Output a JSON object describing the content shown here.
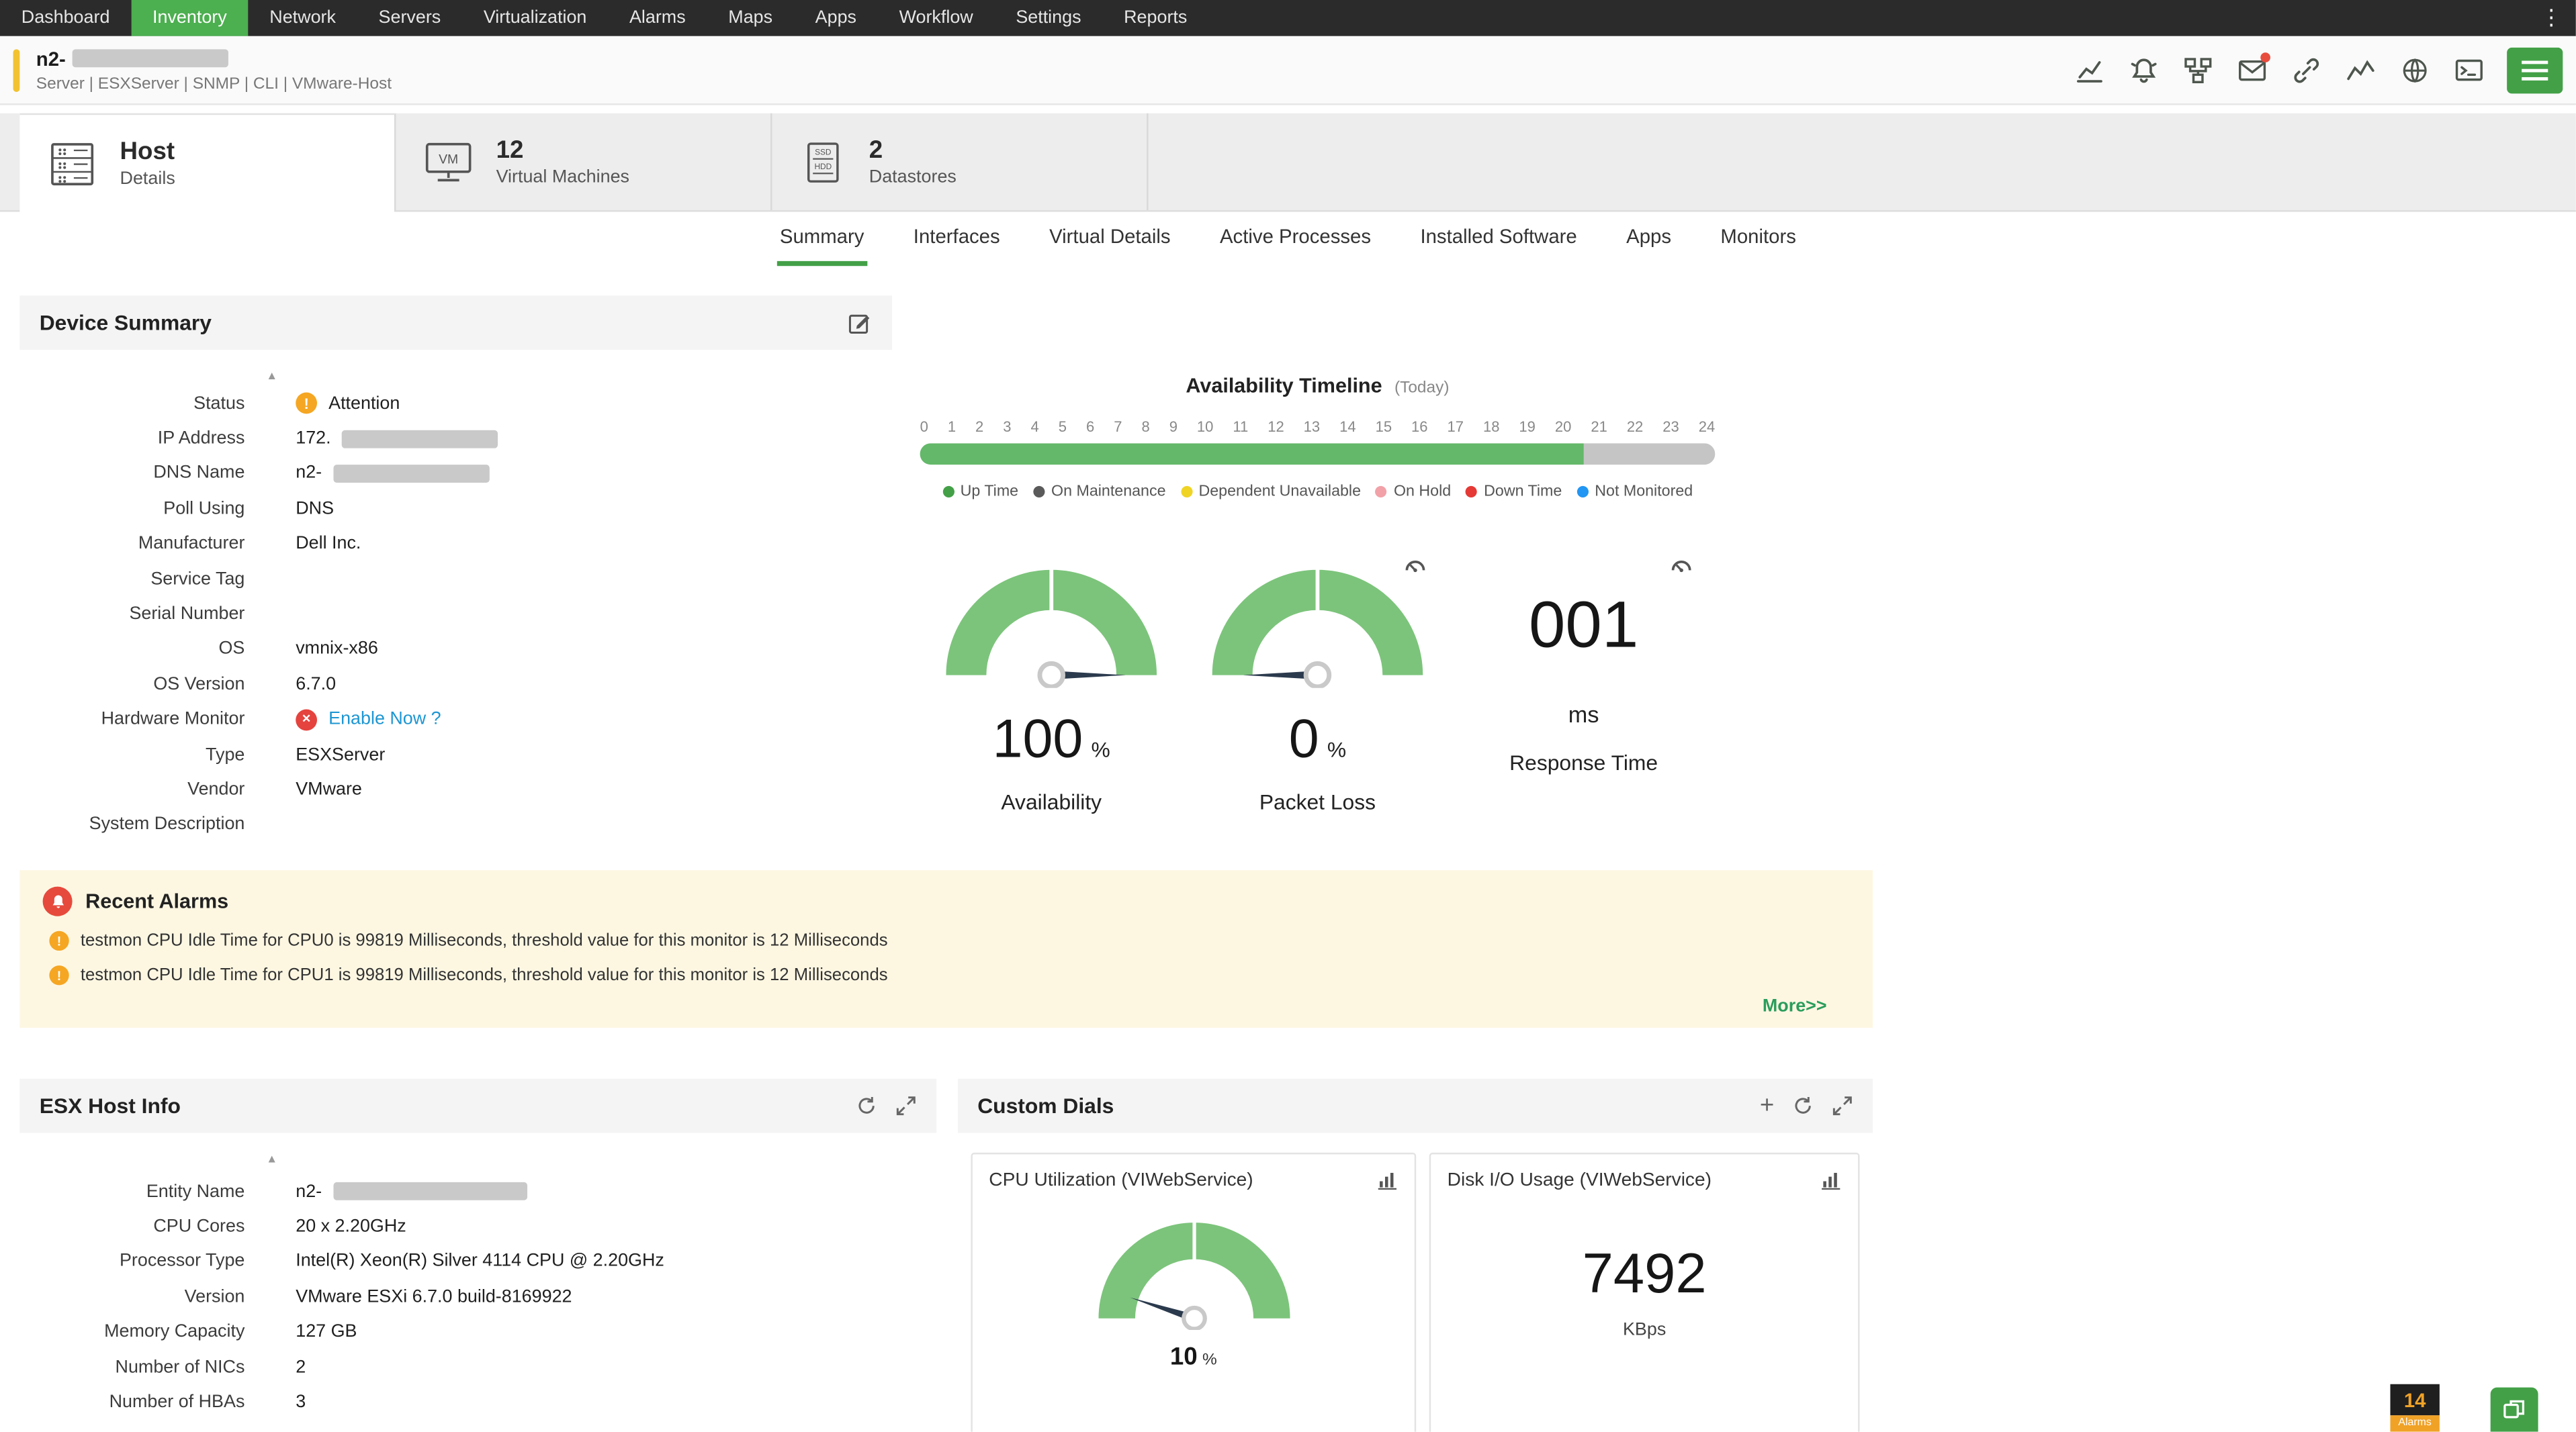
{
  "topnav": {
    "items": [
      {
        "label": "Dashboard",
        "active": false
      },
      {
        "label": "Inventory",
        "active": true
      },
      {
        "label": "Network",
        "active": false
      },
      {
        "label": "Servers",
        "active": false
      },
      {
        "label": "Virtualization",
        "active": false
      },
      {
        "label": "Alarms",
        "active": false
      },
      {
        "label": "Maps",
        "active": false
      },
      {
        "label": "Apps",
        "active": false
      },
      {
        "label": "Workflow",
        "active": false
      },
      {
        "label": "Settings",
        "active": false
      },
      {
        "label": "Reports",
        "active": false
      }
    ]
  },
  "device_header": {
    "name_prefix": "n2-",
    "meta": "Server | ESXServer | SNMP | CLI | VMware-Host"
  },
  "device_tabs": {
    "host": {
      "title": "Host",
      "subtitle": "Details"
    },
    "vms": {
      "count": "12",
      "title": "Virtual Machines"
    },
    "datastores": {
      "count": "2",
      "title": "Datastores"
    }
  },
  "subtabs": [
    {
      "label": "Summary",
      "active": true
    },
    {
      "label": "Interfaces",
      "active": false
    },
    {
      "label": "Virtual Details",
      "active": false
    },
    {
      "label": "Active Processes",
      "active": false
    },
    {
      "label": "Installed Software",
      "active": false
    },
    {
      "label": "Apps",
      "active": false
    },
    {
      "label": "Monitors",
      "active": false
    }
  ],
  "device_summary": {
    "title": "Device Summary",
    "rows": [
      {
        "label": "Status",
        "value": "Attention",
        "warn": true
      },
      {
        "label": "IP Address",
        "value": "172.",
        "redacted": true
      },
      {
        "label": "DNS Name",
        "value": "n2-",
        "redacted": true
      },
      {
        "label": "Poll Using",
        "value": "DNS"
      },
      {
        "label": "Manufacturer",
        "value": "Dell Inc."
      },
      {
        "label": "Service Tag",
        "value": ""
      },
      {
        "label": "Serial Number",
        "value": ""
      },
      {
        "label": "OS",
        "value": "vmnix-x86"
      },
      {
        "label": "OS Version",
        "value": "6.7.0"
      },
      {
        "label": "Hardware Monitor",
        "value": "Enable Now ?",
        "err": true,
        "link": true
      },
      {
        "label": "Type",
        "value": "ESXServer"
      },
      {
        "label": "Vendor",
        "value": "VMware"
      },
      {
        "label": "System Description",
        "value": ""
      }
    ]
  },
  "availability_timeline": {
    "title": "Availability Timeline",
    "subtitle": "(Today)",
    "hours": [
      "0",
      "1",
      "2",
      "3",
      "4",
      "5",
      "6",
      "7",
      "8",
      "9",
      "10",
      "11",
      "12",
      "13",
      "14",
      "15",
      "16",
      "17",
      "18",
      "19",
      "20",
      "21",
      "22",
      "23",
      "24"
    ],
    "uptime_percent": 83.5,
    "legend": [
      {
        "label": "Up Time",
        "color": "#43a047"
      },
      {
        "label": "On Maintenance",
        "color": "#5a5a5a"
      },
      {
        "label": "Dependent Unavailable",
        "color": "#efd426"
      },
      {
        "label": "On Hold",
        "color": "#f2a1a8"
      },
      {
        "label": "Down Time",
        "color": "#e53935"
      },
      {
        "label": "Not Monitored",
        "color": "#2196f3"
      }
    ]
  },
  "metrics": {
    "availability": {
      "value": "100",
      "unit": "%",
      "label": "Availability",
      "percent": 100
    },
    "packet_loss": {
      "value": "0",
      "unit": "%",
      "label": "Packet Loss",
      "percent": 0
    },
    "response_time": {
      "value": "001",
      "unit": "ms",
      "label": "Response Time"
    }
  },
  "recent_alarms": {
    "title": "Recent Alarms",
    "items": [
      {
        "text": "testmon CPU Idle Time for CPU0 is 99819 Milliseconds, threshold value for this monitor is 12 Milliseconds"
      },
      {
        "text": "testmon CPU Idle Time for CPU1 is 99819 Milliseconds, threshold value for this monitor is 12 Milliseconds"
      }
    ],
    "more_label": "More>>"
  },
  "esx_host_info": {
    "title": "ESX Host Info",
    "rows": [
      {
        "label": "Entity Name",
        "value": "n2-",
        "redacted": true,
        "wide": true
      },
      {
        "label": "CPU Cores",
        "value": "20 x 2.20GHz"
      },
      {
        "label": "Processor Type",
        "value": "Intel(R) Xeon(R) Silver 4114 CPU @ 2.20GHz"
      },
      {
        "label": "Version",
        "value": "VMware ESXi 6.7.0 build-8169922"
      },
      {
        "label": "Memory Capacity",
        "value": "127 GB"
      },
      {
        "label": "Number of NICs",
        "value": "2"
      },
      {
        "label": "Number of HBAs",
        "value": "3"
      }
    ]
  },
  "custom_dials": {
    "title": "Custom Dials",
    "cpu_card": {
      "title": "CPU Utilization (VIWebService)",
      "value": "10",
      "unit": "%",
      "percent": 10
    },
    "disk_card": {
      "title": "Disk I/O Usage (VIWebService)",
      "value": "7492",
      "unit": "KBps"
    }
  },
  "floating": {
    "alarm_count": "14",
    "alarm_label": "Alarms"
  },
  "colors": {
    "accent_green": "#4caf50",
    "gauge_green": "#7cc47b",
    "alarm_bg": "#fdf7e2"
  }
}
